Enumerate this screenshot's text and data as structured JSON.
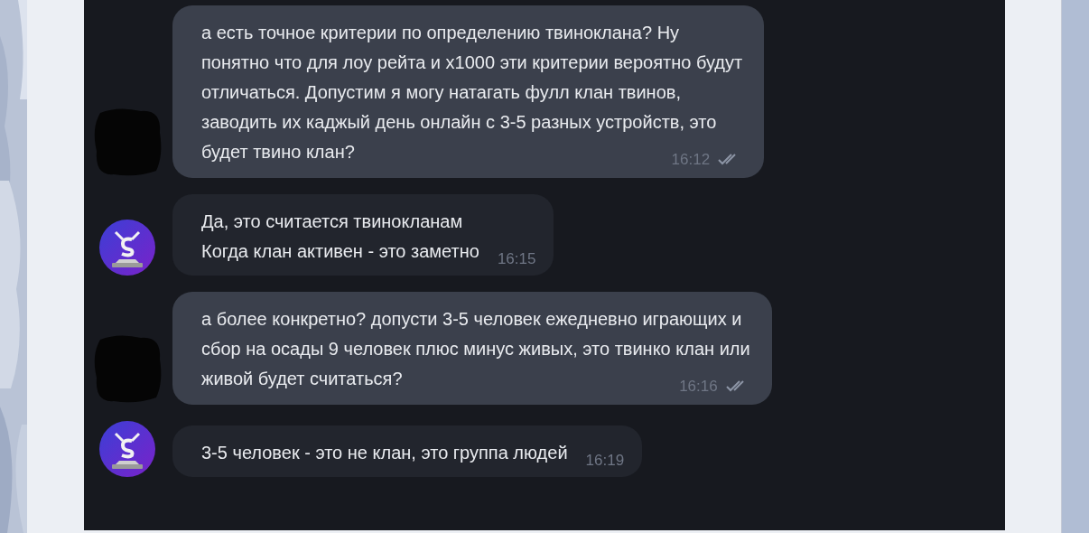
{
  "messages": [
    {
      "kind": "outgoing",
      "avatar": {
        "kind": "redacted"
      },
      "lines": [
        "а есть точное критерии по определению твиноклана? Ну",
        "понятно что для лоу рейта и х1000 эти критерии вероятно будут",
        "отличаться. Допустим я могу натагать фулл клан твинов,",
        "заводить их каджый день онлайн с 3-5 разных устройств, это",
        "будет твино клан?"
      ],
      "time": "16:12",
      "read": true
    },
    {
      "kind": "incoming",
      "avatar": {
        "kind": "logo"
      },
      "lines": [
        "Да, это считается твинокланам",
        "Когда клан активен - это заметно"
      ],
      "time": "16:15"
    },
    {
      "kind": "outgoing",
      "avatar": {
        "kind": "redacted"
      },
      "lines": [
        "а более конкретно? допусти 3-5 человек ежедневно играющих и",
        "сбор на осады 9 человек плюс минус живых, это твинко клан или",
        "живой будет считаться?"
      ],
      "time": "16:16",
      "read": true
    },
    {
      "kind": "incoming",
      "avatar": {
        "kind": "logo"
      },
      "lines": [
        "3-5 человек - это не клан, это группа людей"
      ],
      "time": "16:19"
    }
  ]
}
